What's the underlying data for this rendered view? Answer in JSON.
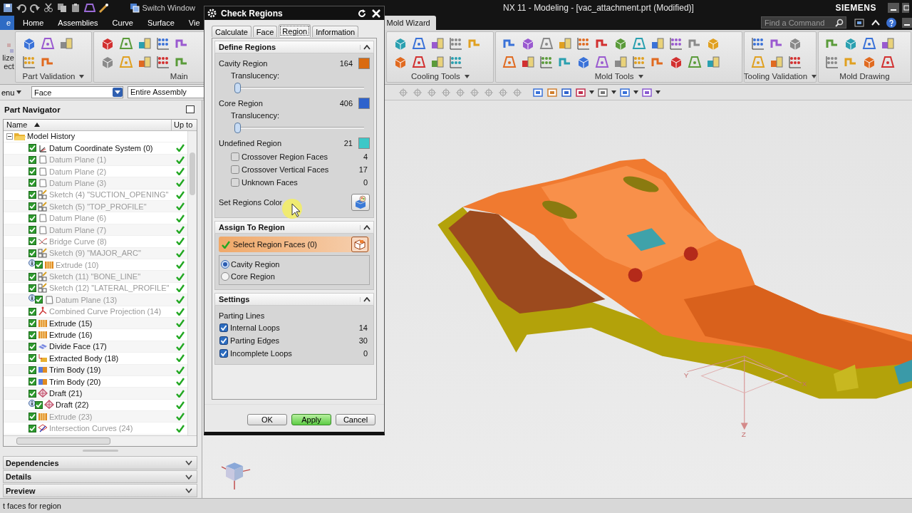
{
  "window": {
    "title": "NX 11 - Modeling - [vac_attachment.prt (Modified)]",
    "brand": "SIEMENS"
  },
  "quick_access": {
    "switch_window": "Switch Window"
  },
  "ribbon_tabs": [
    {
      "label": "e",
      "kind": "file",
      "selected": false
    },
    {
      "label": "Home",
      "kind": "tab",
      "selected": false
    },
    {
      "label": "Assemblies",
      "kind": "tab",
      "selected": false
    },
    {
      "label": "Curve",
      "kind": "tab",
      "selected": false
    },
    {
      "label": "Surface",
      "kind": "tab",
      "selected": false
    },
    {
      "label": "Vie",
      "kind": "tab",
      "selected": false
    },
    {
      "label": "Mold Wizard",
      "kind": "tab",
      "selected": true
    }
  ],
  "command_search": {
    "placeholder": "Find a Command"
  },
  "ribbon_cut_button": {
    "lines": [
      "lize",
      "ect"
    ]
  },
  "ribbon_groups": [
    {
      "label": "Part Validation",
      "menu": true
    },
    {
      "label": "Main",
      "menu": false
    },
    {
      "label": "Cooling Tools",
      "menu": true
    },
    {
      "label": "Mold Tools",
      "menu": true
    },
    {
      "label": "Tooling Validation",
      "menu": true
    },
    {
      "label": "Mold Drawing",
      "menu": false
    }
  ],
  "selection_bar": {
    "menu": "enu",
    "type_filter": "Face",
    "scope": "Entire Assembly"
  },
  "part_navigator": {
    "title": "Part Navigator",
    "columns": [
      "Name",
      "Up to"
    ],
    "root": {
      "label": "Model History",
      "expanded": true,
      "children": [
        {
          "label": "Datum Coordinate System (0)",
          "kind": "csys",
          "checked": true,
          "dimmed": false,
          "info": false,
          "up_to_date": true
        },
        {
          "label": "Datum Plane (1)",
          "kind": "plane",
          "checked": true,
          "dimmed": true,
          "info": false,
          "up_to_date": true
        },
        {
          "label": "Datum Plane (2)",
          "kind": "plane",
          "checked": true,
          "dimmed": true,
          "info": false,
          "up_to_date": true
        },
        {
          "label": "Datum Plane (3)",
          "kind": "plane",
          "checked": true,
          "dimmed": true,
          "info": false,
          "up_to_date": true
        },
        {
          "label": "Sketch (4) \"SUCTION_OPENING\"",
          "kind": "sketch",
          "checked": true,
          "dimmed": true,
          "info": false,
          "up_to_date": true
        },
        {
          "label": "Sketch (5) \"TOP_PROFILE\"",
          "kind": "sketch",
          "checked": true,
          "dimmed": true,
          "info": false,
          "up_to_date": true
        },
        {
          "label": "Datum Plane (6)",
          "kind": "plane",
          "checked": true,
          "dimmed": true,
          "info": false,
          "up_to_date": true
        },
        {
          "label": "Datum Plane (7)",
          "kind": "plane",
          "checked": true,
          "dimmed": true,
          "info": false,
          "up_to_date": true
        },
        {
          "label": "Bridge Curve (8)",
          "kind": "curve",
          "checked": true,
          "dimmed": true,
          "info": false,
          "up_to_date": true
        },
        {
          "label": "Sketch (9) \"MAJOR_ARC\"",
          "kind": "sketch",
          "checked": true,
          "dimmed": true,
          "info": false,
          "up_to_date": true
        },
        {
          "label": "Extrude (10)",
          "kind": "extrude",
          "checked": true,
          "dimmed": true,
          "info": true,
          "up_to_date": true
        },
        {
          "label": "Sketch (11) \"BONE_LINE\"",
          "kind": "sketch",
          "checked": true,
          "dimmed": true,
          "info": false,
          "up_to_date": true
        },
        {
          "label": "Sketch (12) \"LATERAL_PROFILE\"",
          "kind": "sketch",
          "checked": true,
          "dimmed": true,
          "info": false,
          "up_to_date": true
        },
        {
          "label": "Datum Plane (13)",
          "kind": "plane",
          "checked": true,
          "dimmed": true,
          "info": true,
          "up_to_date": true
        },
        {
          "label": "Combined Curve Projection (14)",
          "kind": "projection",
          "checked": true,
          "dimmed": true,
          "info": false,
          "up_to_date": true
        },
        {
          "label": "Extrude (15)",
          "kind": "extrude",
          "checked": true,
          "dimmed": false,
          "info": false,
          "up_to_date": true
        },
        {
          "label": "Extrude (16)",
          "kind": "extrude",
          "checked": true,
          "dimmed": false,
          "info": false,
          "up_to_date": true
        },
        {
          "label": "Divide Face (17)",
          "kind": "divide",
          "checked": true,
          "dimmed": false,
          "info": false,
          "up_to_date": true
        },
        {
          "label": "Extracted Body (18)",
          "kind": "extract",
          "checked": true,
          "dimmed": false,
          "info": false,
          "up_to_date": true
        },
        {
          "label": "Trim Body (19)",
          "kind": "trim",
          "checked": true,
          "dimmed": false,
          "info": false,
          "up_to_date": true
        },
        {
          "label": "Trim Body (20)",
          "kind": "trim",
          "checked": true,
          "dimmed": false,
          "info": false,
          "up_to_date": true
        },
        {
          "label": "Draft (21)",
          "kind": "draft",
          "checked": true,
          "dimmed": false,
          "info": false,
          "up_to_date": true
        },
        {
          "label": "Draft (22)",
          "kind": "draft",
          "checked": true,
          "dimmed": false,
          "info": true,
          "up_to_date": true
        },
        {
          "label": "Extrude (23)",
          "kind": "extrude",
          "checked": true,
          "dimmed": true,
          "info": false,
          "up_to_date": true
        },
        {
          "label": "Intersection Curves (24)",
          "kind": "intersect",
          "checked": true,
          "dimmed": true,
          "info": false,
          "up_to_date": true
        }
      ]
    },
    "panels": [
      {
        "title": "Dependencies",
        "expanded": false
      },
      {
        "title": "Details",
        "expanded": false
      },
      {
        "title": "Preview",
        "expanded": false
      }
    ]
  },
  "viewport": {
    "wcs_labels": [
      "Y",
      "X",
      "Z"
    ]
  },
  "dialog": {
    "title": "Check Regions",
    "tabs": [
      {
        "label": "Calculate",
        "selected": false
      },
      {
        "label": "Face",
        "selected": false
      },
      {
        "label": "Region",
        "selected": true
      },
      {
        "label": "Information",
        "selected": false
      }
    ],
    "define_regions": {
      "title": "Define Regions",
      "expanded": true,
      "regions": [
        {
          "name": "Cavity Region",
          "count": "164",
          "color": "#d96a10",
          "translucency": {
            "label": "Translucency:",
            "level": 0
          }
        },
        {
          "name": "Core Region",
          "count": "406",
          "color": "#2f63cc",
          "translucency": {
            "label": "Translucency:",
            "level": 0
          }
        },
        {
          "name": "Undefined Region",
          "count": "21",
          "color": "#3cc8c8"
        }
      ],
      "faces": [
        {
          "label": "Crossover Region Faces",
          "count": "4",
          "checked": false
        },
        {
          "label": "Crossover Vertical Faces",
          "count": "17",
          "checked": false
        },
        {
          "label": "Unknown Faces",
          "count": "0",
          "checked": false
        }
      ],
      "set_color_label": "Set Regions Color"
    },
    "assign_to_region": {
      "title": "Assign To Region",
      "expanded": true,
      "select": {
        "label": "Select Region Faces (0)",
        "active": true
      },
      "options": [
        {
          "label": "Cavity Region",
          "selected": true
        },
        {
          "label": "Core Region",
          "selected": false
        }
      ]
    },
    "settings": {
      "title": "Settings",
      "expanded": true,
      "group_label": "Parting Lines",
      "items": [
        {
          "label": "Internal Loops",
          "count": "14",
          "checked": true
        },
        {
          "label": "Parting Edges",
          "count": "30",
          "checked": true
        },
        {
          "label": "Incomplete Loops",
          "count": "0",
          "checked": true
        }
      ]
    },
    "buttons": [
      {
        "label": "OK",
        "kind": "normal"
      },
      {
        "label": "Apply",
        "kind": "primary"
      },
      {
        "label": "Cancel",
        "kind": "normal"
      }
    ]
  },
  "status_bar": {
    "message": "t faces for region"
  }
}
